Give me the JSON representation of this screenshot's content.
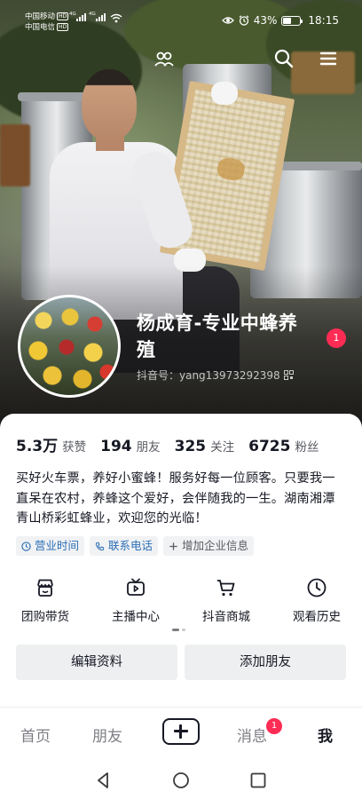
{
  "status_bar": {
    "carrier_1": "中国移动",
    "carrier_2": "中国电信",
    "hd_badge": "HD",
    "net_type": "4G",
    "battery_percent": "43%",
    "battery_level": 0.43,
    "time": "18:15"
  },
  "top_nav": {
    "friends_icon": "people-icon",
    "search_icon": "search-icon",
    "menu_icon": "menu-icon"
  },
  "profile": {
    "name": "杨成育-专业中蜂养殖",
    "douyin_id": "抖音号：yang13973292398",
    "notification_count": "1"
  },
  "stats": [
    {
      "value": "5.3万",
      "label": "获赞"
    },
    {
      "value": "194",
      "label": "朋友"
    },
    {
      "value": "325",
      "label": "关注"
    },
    {
      "value": "6725",
      "label": "粉丝"
    }
  ],
  "bio": "买好火车票，养好小蜜蜂！服务好每一位顾客。只要我一直呆在农村，养蜂这个爱好，会伴随我的一生。湖南湘潭青山桥彩虹蜂业，欢迎您的光临！",
  "tags": [
    {
      "label": "营业时间",
      "icon": "clock-icon"
    },
    {
      "label": "联系电话",
      "icon": "phone-icon"
    },
    {
      "label": "增加企业信息",
      "icon": "plus-icon"
    }
  ],
  "features": [
    {
      "label": "团购带货",
      "icon": "shop-icon"
    },
    {
      "label": "主播中心",
      "icon": "tv-icon"
    },
    {
      "label": "抖音商城",
      "icon": "cart-icon"
    },
    {
      "label": "观看历史",
      "icon": "clock-icon"
    }
  ],
  "buttons": {
    "edit_profile": "编辑资料",
    "add_friend": "添加朋友"
  },
  "tabbar": {
    "home": "首页",
    "friends": "朋友",
    "create_icon": "plus-icon",
    "messages": "消息",
    "messages_badge": "1",
    "me": "我"
  },
  "colors": {
    "accent_red": "#fe2c55",
    "link_blue": "#2b6fb6",
    "text_primary": "#161823",
    "button_bg": "#eeeff1"
  }
}
